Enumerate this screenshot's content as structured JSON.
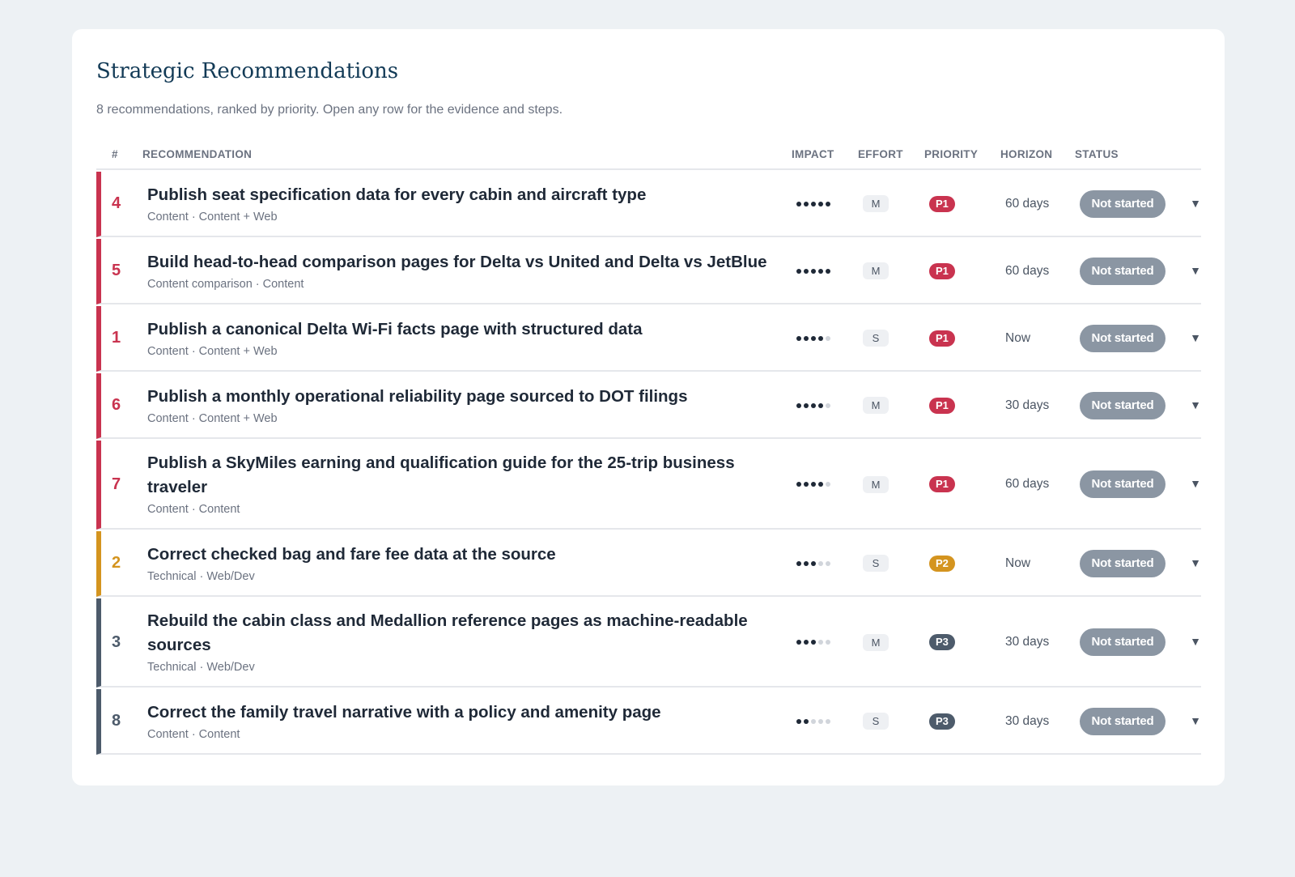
{
  "card": {
    "title": "Strategic Recommendations",
    "subtitle": "8 recommendations, ranked by priority. Open any row for the evidence and steps."
  },
  "columns": {
    "num": "#",
    "recommendation": "RECOMMENDATION",
    "impact": "IMPACT",
    "effort": "EFFORT",
    "priority": "PRIORITY",
    "horizon": "HORIZON",
    "status": "STATUS"
  },
  "priority_colors": {
    "P1": "#c9334f",
    "P2": "#d4941f",
    "P3": "#4d5b6b"
  },
  "rows": [
    {
      "num": "4",
      "title": "Publish seat specification data for every cabin and aircraft type",
      "meta": "Content · Content + Web",
      "impact": 5,
      "effort": "M",
      "priority": "P1",
      "horizon": "60 days",
      "status": "Not started",
      "expand_icon": "chevron-down-icon"
    },
    {
      "num": "5",
      "title": "Build head-to-head comparison pages for Delta vs United and Delta vs JetBlue",
      "meta": "Content comparison · Content",
      "impact": 5,
      "effort": "M",
      "priority": "P1",
      "horizon": "60 days",
      "status": "Not started",
      "expand_icon": "chevron-down-icon"
    },
    {
      "num": "1",
      "title": "Publish a canonical Delta Wi-Fi facts page with structured data",
      "meta": "Content · Content + Web",
      "impact": 4,
      "effort": "S",
      "priority": "P1",
      "horizon": "Now",
      "status": "Not started",
      "expand_icon": "chevron-down-icon"
    },
    {
      "num": "6",
      "title": "Publish a monthly operational reliability page sourced to DOT filings",
      "meta": "Content · Content + Web",
      "impact": 4,
      "effort": "M",
      "priority": "P1",
      "horizon": "30 days",
      "status": "Not started",
      "expand_icon": "chevron-down-icon"
    },
    {
      "num": "7",
      "title": "Publish a SkyMiles earning and qualification guide for the 25-trip business traveler",
      "meta": "Content · Content",
      "impact": 4,
      "effort": "M",
      "priority": "P1",
      "horizon": "60 days",
      "status": "Not started",
      "expand_icon": "chevron-down-icon"
    },
    {
      "num": "2",
      "title": "Correct checked bag and fare fee data at the source",
      "meta": "Technical · Web/Dev",
      "impact": 3,
      "effort": "S",
      "priority": "P2",
      "horizon": "Now",
      "status": "Not started",
      "expand_icon": "chevron-down-icon"
    },
    {
      "num": "3",
      "title": "Rebuild the cabin class and Medallion reference pages as machine-readable sources",
      "meta": "Technical · Web/Dev",
      "impact": 3,
      "effort": "M",
      "priority": "P3",
      "horizon": "30 days",
      "status": "Not started",
      "expand_icon": "chevron-down-icon"
    },
    {
      "num": "8",
      "title": "Correct the family travel narrative with a policy and amenity page",
      "meta": "Content · Content",
      "impact": 2,
      "effort": "S",
      "priority": "P3",
      "horizon": "30 days",
      "status": "Not started",
      "expand_icon": "chevron-down-icon"
    }
  ]
}
